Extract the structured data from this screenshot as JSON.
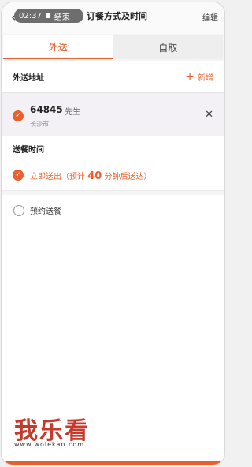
{
  "status_pill": {
    "time": "02:37",
    "end_label": "结束"
  },
  "header": {
    "title": "订餐方式及时间",
    "edit_label": "编辑"
  },
  "tabs": [
    {
      "label": "外送",
      "active": true
    },
    {
      "label": "自取",
      "active": false
    }
  ],
  "address_section": {
    "label": "外送地址",
    "add_label": "新增"
  },
  "address": {
    "name": "64845",
    "honorific": "先生",
    "city": "长沙市"
  },
  "time_section": {
    "label": "送餐时间"
  },
  "delivery_now": {
    "prefix": "立即送出（预计 ",
    "minutes": "40",
    "suffix": " 分钟后送达）"
  },
  "schedule_option": {
    "label": "预约送餐"
  },
  "watermark": {
    "logo": "我乐看",
    "url": "www.wolekan.com"
  },
  "colors": {
    "accent": "#e8602c"
  }
}
